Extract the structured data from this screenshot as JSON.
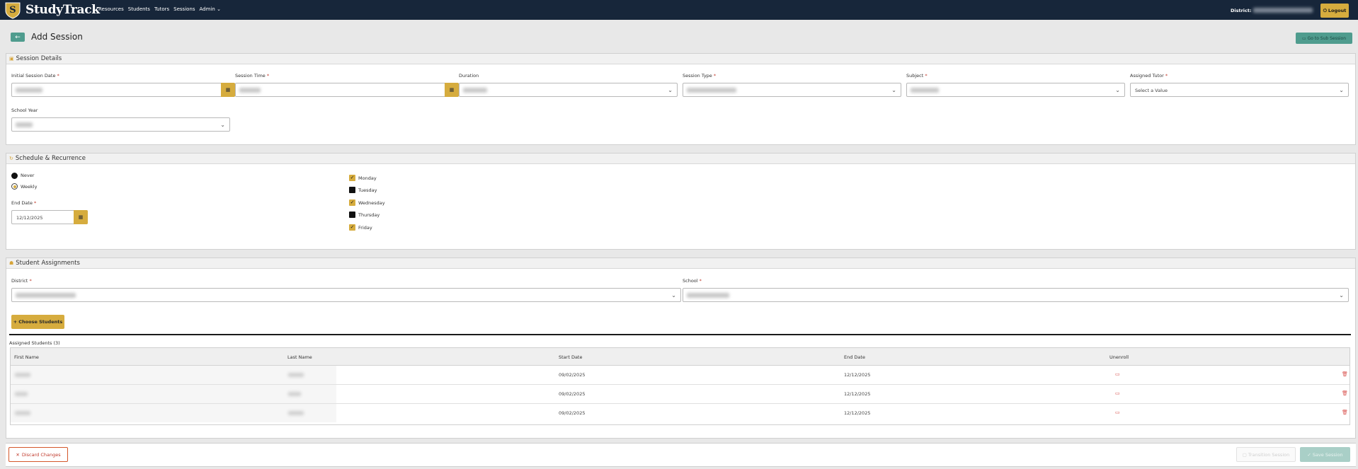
{
  "app": {
    "brand": "StudyTrack",
    "nav": [
      "Resources",
      "Students",
      "Tutors",
      "Sessions",
      "Admin"
    ],
    "district_label": "District:",
    "logout": "Logout"
  },
  "header": {
    "title": "Add Session",
    "goto_sub_session": "Go to Sub Session"
  },
  "session_details": {
    "title": "Session Details",
    "initial_date_label": "Initial Session Date",
    "session_time_label": "Session Time",
    "duration_label": "Duration",
    "session_type_label": "Session Type",
    "subject_label": "Subject",
    "assigned_tutor_label": "Assigned Tutor",
    "assigned_tutor_placeholder": "Select a Value",
    "school_year_label": "School Year",
    "required_mark": "*"
  },
  "schedule": {
    "title": "Schedule & Recurrence",
    "recurrence": [
      {
        "label": "Never",
        "selected": false
      },
      {
        "label": "Weekly",
        "selected": true
      }
    ],
    "end_date_label": "End Date",
    "end_date_value": "12/12/2025",
    "days": [
      {
        "label": "Monday",
        "checked": true
      },
      {
        "label": "Tuesday",
        "checked": false
      },
      {
        "label": "Wednesday",
        "checked": true
      },
      {
        "label": "Thursday",
        "checked": false
      },
      {
        "label": "Friday",
        "checked": true
      }
    ]
  },
  "students": {
    "title": "Student Assignments",
    "district_label": "District",
    "school_label": "School",
    "choose_students": "Choose Students",
    "assigned_title": "Assigned Students (3)",
    "columns": [
      "First Name",
      "Last Name",
      "Start Date",
      "End Date",
      "Unenroll"
    ],
    "rows": [
      {
        "start": "09/02/2025",
        "end": "12/12/2025"
      },
      {
        "start": "09/02/2025",
        "end": "12/12/2025"
      },
      {
        "start": "09/02/2025",
        "end": "12/12/2025"
      }
    ]
  },
  "footer": {
    "discard": "Discard Changes",
    "transition": "Transition Session",
    "save": "Save Session"
  },
  "colors": {
    "navbar": "#17263a",
    "accent_gold": "#d6ac3e",
    "accent_teal": "#4f9c8e",
    "danger": "#d4572a"
  }
}
